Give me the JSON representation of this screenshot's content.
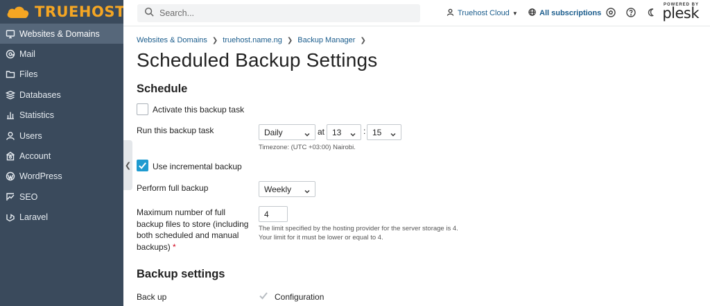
{
  "brand": {
    "name": "TRUEHOST",
    "accent": "#f5a623",
    "sidebar_bg": "#3a4a5c"
  },
  "sidebar": {
    "items": [
      {
        "label": "Websites & Domains",
        "icon": "monitor-icon",
        "active": true
      },
      {
        "label": "Mail",
        "icon": "mail-icon"
      },
      {
        "label": "Files",
        "icon": "folder-icon"
      },
      {
        "label": "Databases",
        "icon": "database-icon"
      },
      {
        "label": "Statistics",
        "icon": "bar-chart-icon"
      },
      {
        "label": "Users",
        "icon": "user-icon"
      },
      {
        "label": "Account",
        "icon": "account-icon"
      },
      {
        "label": "WordPress",
        "icon": "wordpress-icon"
      },
      {
        "label": "SEO",
        "icon": "seo-icon"
      },
      {
        "label": "Laravel",
        "icon": "laravel-icon"
      }
    ]
  },
  "topbar": {
    "search_placeholder": "Search...",
    "account_label": "Truehost Cloud",
    "subscriptions_label": "All subscriptions",
    "powered_by": "POWERED BY",
    "plesk": "plesk"
  },
  "breadcrumb": [
    "Websites & Domains",
    "truehost.name.ng",
    "Backup Manager"
  ],
  "page_title": "Scheduled Backup Settings",
  "schedule": {
    "section_title": "Schedule",
    "activate_label": "Activate this backup task",
    "activate_checked": false,
    "run_label": "Run this backup task",
    "frequency_value": "Daily",
    "at_label": "at",
    "hour_value": "13",
    "colon": ":",
    "minute_value": "15",
    "timezone_hint": "Timezone: (UTC +03:00) Nairobi.",
    "incremental_label": "Use incremental backup",
    "incremental_checked": true,
    "full_backup_label": "Perform full backup",
    "full_backup_value": "Weekly",
    "max_label_lines": [
      "Maximum number of full",
      "backup files to store (including",
      "both scheduled and manual",
      "backups)"
    ],
    "required_mark": "*",
    "max_value": "4",
    "max_hint_lines": [
      "The limit specified by the hosting provider for the server storage is 4.",
      "Your limit for it must be lower or equal to 4."
    ]
  },
  "backup_settings": {
    "section_title": "Backup settings",
    "backup_label": "Back up",
    "configuration_label": "Configuration",
    "configuration_checked": true
  }
}
